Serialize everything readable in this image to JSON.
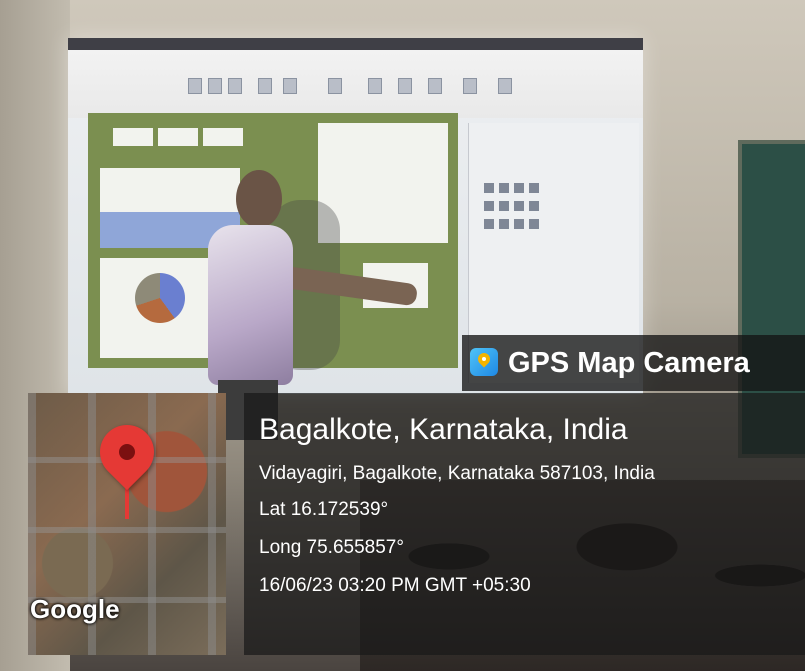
{
  "overlay": {
    "brand": "GPS Map Camera",
    "place": "Bagalkote, Karnataka, India",
    "address": "Vidayagiri, Bagalkote, Karnataka 587103, India",
    "lat": "Lat 16.172539°",
    "long": "Long 75.655857°",
    "datetime": "16/06/23 03:20 PM GMT +05:30"
  },
  "map": {
    "attribution": "Google"
  },
  "icons": {
    "brand_logo": "gps-map-camera-logo-icon",
    "location": "map-pin-icon"
  },
  "colors": {
    "pin": "#e53935",
    "overlay_bg": "#191919",
    "text": "#ffffff"
  }
}
